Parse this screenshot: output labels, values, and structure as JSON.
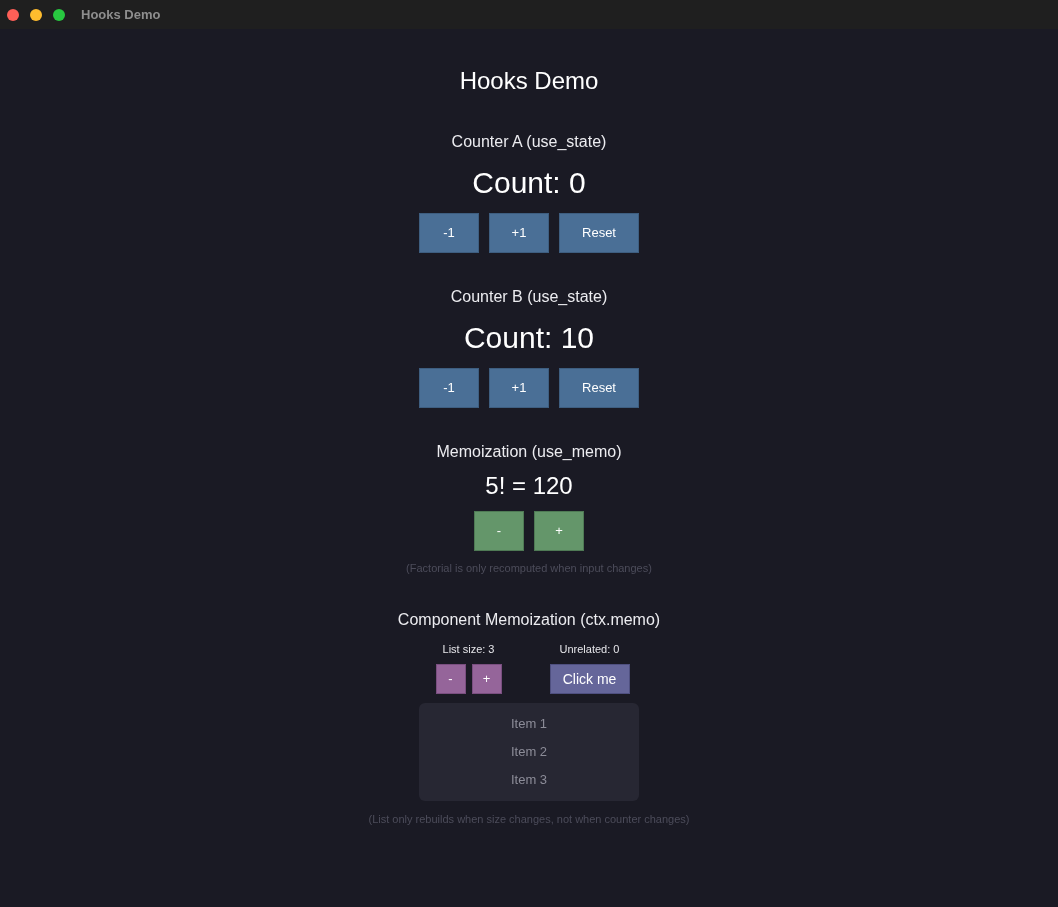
{
  "window": {
    "title": "Hooks Demo"
  },
  "heading": "Hooks Demo",
  "sections": [
    {
      "kind": "counter",
      "title": "Counter A (use_state)",
      "display": "Count: 0",
      "buttons": [
        "-1",
        "+1",
        "Reset"
      ]
    },
    {
      "kind": "counter",
      "title": "Counter B (use_state)",
      "display": "Count: 10",
      "buttons": [
        "-1",
        "+1",
        "Reset"
      ]
    },
    {
      "kind": "memo",
      "title": "Memoization (use_memo)",
      "display": "5! = 120",
      "buttons": [
        "-",
        "+"
      ],
      "note": "(Factorial is only recomputed when input changes)"
    },
    {
      "kind": "component_memo",
      "title": "Component Memoization (ctx.memo)",
      "groups": [
        {
          "label": "List size: 3",
          "buttons": [
            "-",
            "+"
          ]
        },
        {
          "label": "Unrelated: 0",
          "buttons": [
            "Click me"
          ]
        }
      ],
      "items": [
        "Item 1",
        "Item 2",
        "Item 3"
      ],
      "note": "(List only rebuilds when size changes, not when counter changes)"
    }
  ]
}
